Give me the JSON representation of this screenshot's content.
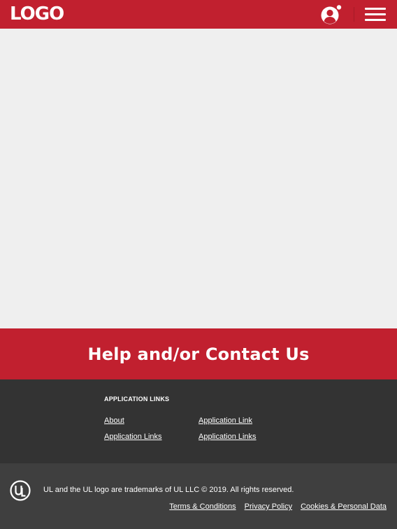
{
  "header": {
    "logo_text": "LOGO",
    "brand_color": "#c1202f",
    "user_icon": "user-account-icon",
    "menu_icon": "hamburger-menu-icon"
  },
  "help": {
    "title": "Help and/or Contact Us"
  },
  "app_links": {
    "heading": "APPLICATION LINKS",
    "items": [
      {
        "label": "About"
      },
      {
        "label": "Application Link"
      },
      {
        "label": "Application Links"
      },
      {
        "label": "Application Links"
      }
    ]
  },
  "footer": {
    "logo_icon": "ul-logo-icon",
    "logo_text": "UL",
    "copyright": "UL and the UL logo are trademarks of UL LLC © 2019. All rights reserved.",
    "links": [
      {
        "label": "Terms & Conditions"
      },
      {
        "label": "Privacy Policy"
      },
      {
        "label": "Cookies & Personal Data"
      }
    ]
  }
}
